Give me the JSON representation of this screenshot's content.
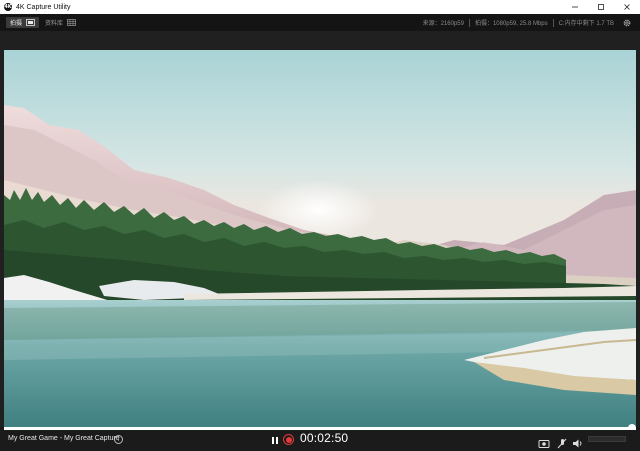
{
  "window": {
    "title": "4K Capture Utility",
    "app_icon_letter": "4K",
    "controls": [
      "minimize",
      "maximize",
      "close"
    ]
  },
  "toolbar": {
    "tabs": [
      {
        "label": "拍摄",
        "icon": "capture-screen-icon",
        "active": true
      },
      {
        "label": "资料库",
        "icon": "library-grid-icon",
        "active": false
      }
    ],
    "source_label": "来源：2160p59",
    "recording_label": "拍摄：1080p59, 25.8 Mbps",
    "storage_label": "C:内存中剩下 1.7 TB",
    "settings_icon": "gear-icon"
  },
  "preview": {
    "description_icon": "preview-image"
  },
  "playback": {
    "capture_name": "My Great Game - My Great Capture",
    "timer": "00:02:50",
    "progress_fraction": 1.0,
    "recording": true
  },
  "colors": {
    "record_red": "#e23a3a",
    "toolbar_bg": "#141414",
    "app_bg": "#1b1b1b"
  }
}
